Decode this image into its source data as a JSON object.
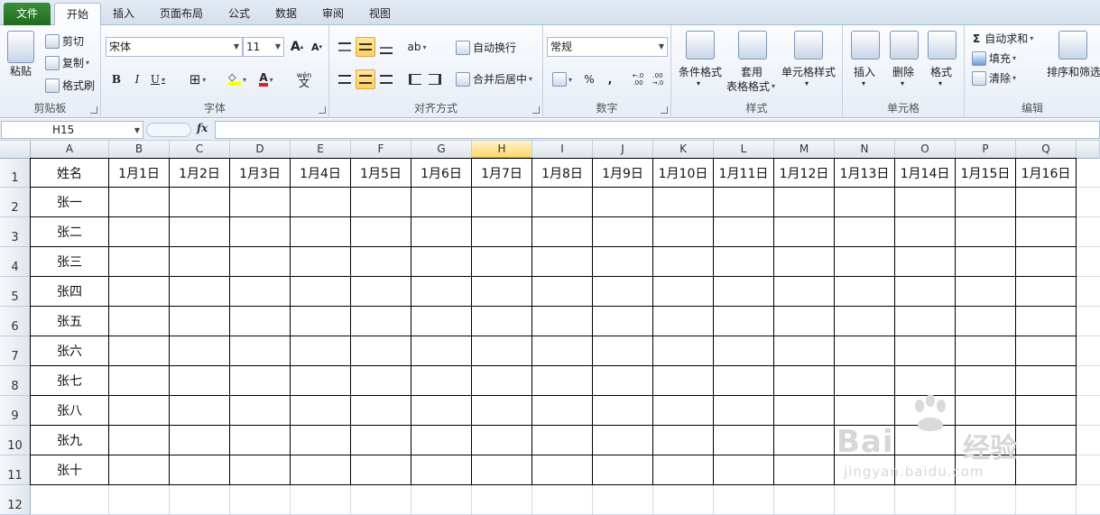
{
  "tabs": {
    "file": "文件",
    "items": [
      "开始",
      "插入",
      "页面布局",
      "公式",
      "数据",
      "审阅",
      "视图"
    ],
    "active": 0
  },
  "ribbon": {
    "clipboard": {
      "paste": "粘贴",
      "cut": "剪切",
      "copy": "复制",
      "format_painter": "格式刷",
      "label": "剪贴板"
    },
    "font": {
      "name": "宋体",
      "size": "11",
      "label": "字体",
      "bold": "B",
      "italic": "I",
      "underline": "U",
      "grow": "A",
      "shrink": "A",
      "color_letter": "A",
      "phonetic": "wén"
    },
    "alignment": {
      "wrap": "自动换行",
      "merge": "合并后居中",
      "label": "对齐方式"
    },
    "number": {
      "format": "常规",
      "percent": "%",
      "comma": ",",
      "inc_decimal": "←.0 .00",
      "dec_decimal": ".00 →.0",
      "label": "数字"
    },
    "styles": {
      "conditional": "条件格式",
      "table_line1": "套用",
      "table_line2": "表格格式",
      "cell_styles": "单元格样式",
      "label": "样式"
    },
    "cells": {
      "insert": "插入",
      "delete": "删除",
      "format": "格式",
      "label": "单元格"
    },
    "editing": {
      "autosum": "自动求和",
      "fill": "填充",
      "clear": "清除",
      "sort": "排序和筛选",
      "label": "编辑"
    }
  },
  "formula_bar": {
    "name_box": "H15",
    "fx": "fx",
    "formula": ""
  },
  "sheet": {
    "columns": [
      "A",
      "B",
      "C",
      "D",
      "E",
      "F",
      "G",
      "H",
      "I",
      "J",
      "K",
      "L",
      "M",
      "N",
      "O",
      "P",
      "Q"
    ],
    "selected_column": "H",
    "rows": [
      "1",
      "2",
      "3",
      "4",
      "5",
      "6",
      "7",
      "8",
      "9",
      "10",
      "11",
      "12"
    ],
    "header_row": [
      "姓名",
      "1月1日",
      "1月2日",
      "1月3日",
      "1月4日",
      "1月5日",
      "1月6日",
      "1月7日",
      "1月8日",
      "1月9日",
      "1月10日",
      "1月11日",
      "1月12日",
      "1月13日",
      "1月14日",
      "1月15日",
      "1月16日"
    ],
    "names": [
      "张一",
      "张二",
      "张三",
      "张四",
      "张五",
      "张六",
      "张七",
      "张八",
      "张九",
      "张十"
    ]
  },
  "watermark": {
    "text": "Bai",
    "text2": "经验",
    "url": "jingyan.baidu.com"
  },
  "colors": {
    "accent": "#1f6b1d",
    "selected_header": "#ffd76e",
    "table_border": "#000000"
  }
}
